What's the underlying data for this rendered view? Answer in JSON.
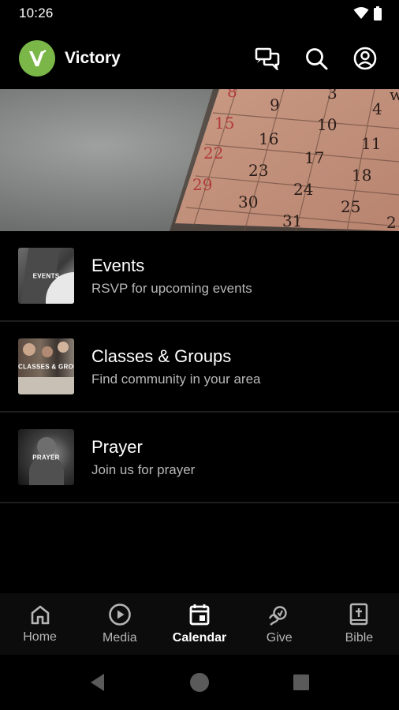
{
  "status_bar": {
    "time": "10:26"
  },
  "header": {
    "app_name": "Victory",
    "brand_color": "#7ab648"
  },
  "hero": {
    "calendar_numbers": [
      "8",
      "9",
      "3",
      "4",
      "w",
      "15",
      "16",
      "10",
      "11",
      "22",
      "23",
      "17",
      "18",
      "29",
      "30",
      "24",
      "25",
      "31",
      "2"
    ]
  },
  "list": [
    {
      "title": "Events",
      "subtitle": "RSVP for upcoming events",
      "thumb_label": "EVENTS"
    },
    {
      "title": "Classes & Groups",
      "subtitle": "Find community in your area",
      "thumb_label": "CLASSES & GROUPS"
    },
    {
      "title": "Prayer",
      "subtitle": "Join us for prayer",
      "thumb_label": "PRAYER"
    }
  ],
  "bottom_nav": [
    {
      "label": "Home",
      "icon": "home-icon"
    },
    {
      "label": "Media",
      "icon": "play-icon"
    },
    {
      "label": "Calendar",
      "icon": "calendar-icon",
      "active": true
    },
    {
      "label": "Give",
      "icon": "give-icon"
    },
    {
      "label": "Bible",
      "icon": "bible-icon"
    }
  ],
  "system_nav": [
    "back-icon",
    "home-circle-icon",
    "recents-icon"
  ]
}
